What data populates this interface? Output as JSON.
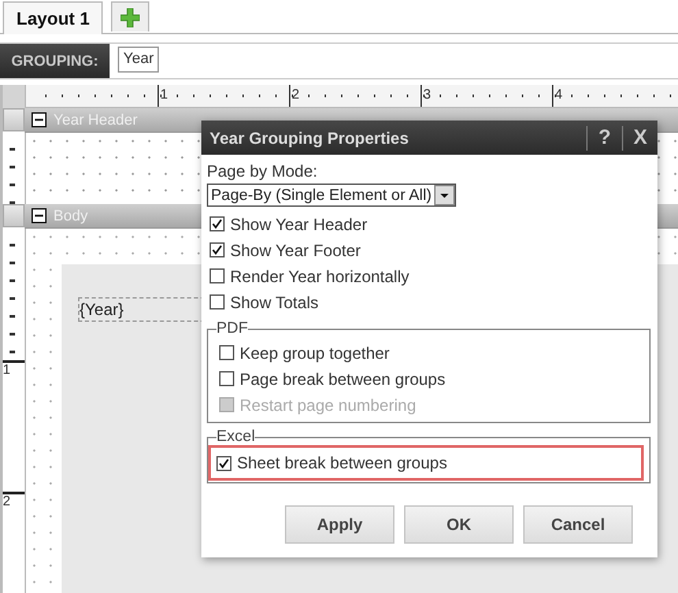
{
  "tabs": [
    {
      "label": "Layout 1",
      "selected": true
    }
  ],
  "grouping": {
    "label": "GROUPING:",
    "fields": [
      "Year"
    ]
  },
  "ruler": {
    "top_labels": [
      "1",
      "2",
      "3",
      "4"
    ],
    "side_labels": [
      "1",
      "2"
    ]
  },
  "bands": [
    {
      "title": "Year Header",
      "expanded": true
    },
    {
      "title": "Body",
      "expanded": true
    }
  ],
  "report_field": "{Year}",
  "dialog": {
    "title": "Year Grouping Properties",
    "help": "?",
    "close": "X",
    "mode_label": "Page by Mode:",
    "mode_value": "Page-By (Single Element or All)",
    "options": [
      {
        "label": "Show Year Header",
        "checked": true,
        "disabled": false
      },
      {
        "label": "Show Year Footer",
        "checked": true,
        "disabled": false
      },
      {
        "label": "Render Year horizontally",
        "checked": false,
        "disabled": false
      },
      {
        "label": "Show Totals",
        "checked": false,
        "disabled": false
      }
    ],
    "groups": [
      {
        "title": "PDF",
        "options": [
          {
            "label": "Keep group together",
            "checked": false,
            "disabled": false,
            "highlighted": false
          },
          {
            "label": "Page break between groups",
            "checked": false,
            "disabled": false,
            "highlighted": false
          },
          {
            "label": "Restart page numbering",
            "checked": false,
            "disabled": true,
            "highlighted": false
          }
        ]
      },
      {
        "title": "Excel",
        "options": [
          {
            "label": "Sheet break between groups",
            "checked": true,
            "disabled": false,
            "highlighted": true
          }
        ]
      }
    ],
    "buttons": [
      "Apply",
      "OK",
      "Cancel"
    ]
  }
}
